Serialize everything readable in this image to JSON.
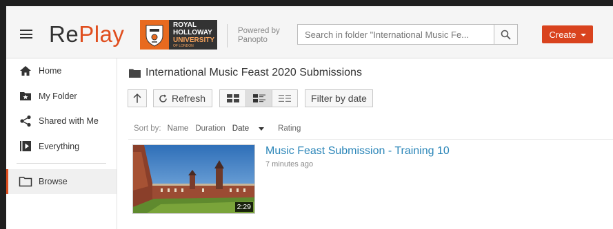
{
  "header": {
    "brand_re": "Re",
    "brand_play": "Play",
    "logo": {
      "line1": "ROYAL",
      "line2": "HOLLOWAY",
      "line3": "UNIVERSITY",
      "line4": "OF LONDON"
    },
    "powered_by": "Powered by",
    "panopto": "Panopto",
    "search_placeholder": "Search in folder \"International Music Fe...",
    "create_label": "Create"
  },
  "sidebar": {
    "items": [
      {
        "label": "Home",
        "icon": "home-icon"
      },
      {
        "label": "My Folder",
        "icon": "star-folder-icon"
      },
      {
        "label": "Shared with Me",
        "icon": "share-icon"
      },
      {
        "label": "Everything",
        "icon": "play-library-icon"
      }
    ],
    "browse": {
      "label": "Browse",
      "icon": "folder-outline-icon"
    }
  },
  "main": {
    "folder_title": "International Music Feast 2020 Submissions",
    "toolbar": {
      "refresh_label": "Refresh",
      "filter_label": "Filter by date"
    },
    "sort": {
      "label": "Sort by:",
      "columns": [
        "Name",
        "Duration",
        "Date",
        "Rating"
      ],
      "active": "Date"
    },
    "sessions": [
      {
        "title": "Music Feast Submission - Training 10",
        "age": "7 minutes ago",
        "duration": "2:29"
      }
    ]
  },
  "colors": {
    "accent": "#e04e1e",
    "create_button": "#d9431e",
    "link": "#2a85b8",
    "logo_orange": "#e86a1f"
  }
}
